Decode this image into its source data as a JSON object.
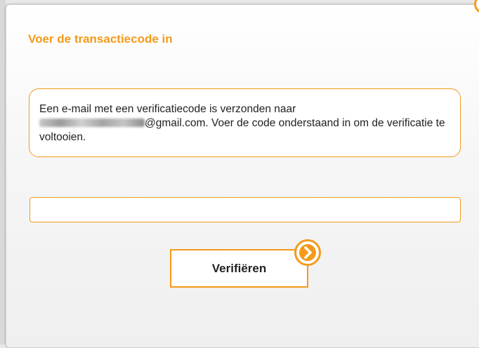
{
  "dialog": {
    "title": "Voer de transactiecode in",
    "message_prefix": "Een e-mail met een verificatiecode is verzonden naar",
    "email_domain": "@gmail.com.",
    "message_suffix": "Voer de code onderstaand in om de verificatie te voltooien."
  },
  "code_input": {
    "value": "",
    "placeholder": ""
  },
  "verify_button": {
    "label": "Verifiëren",
    "icon": "chevron-right-icon"
  },
  "colors": {
    "accent": "#f39a1b",
    "text": "#222222",
    "background": "#ffffff"
  }
}
